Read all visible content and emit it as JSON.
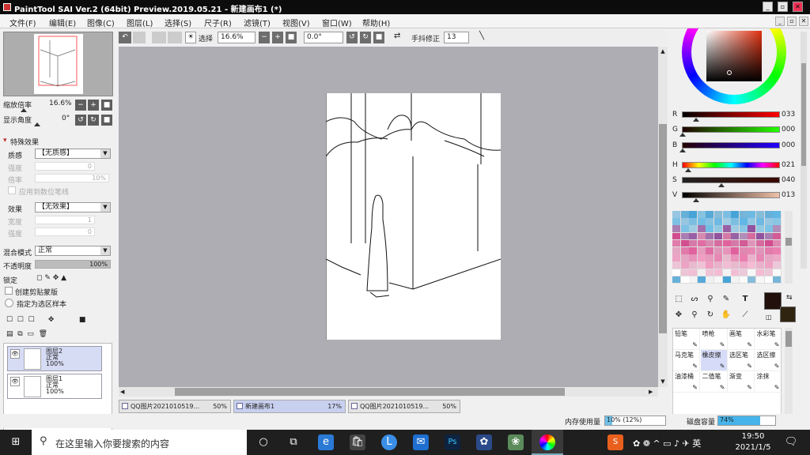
{
  "window": {
    "title": "PaintTool SAI Ver.2 (64bit) Preview.2019.05.21 - 新建画布1 (*)",
    "min": "_",
    "max": "▫",
    "close": "✕"
  },
  "menu": [
    "文件(F)",
    "编辑(E)",
    "图像(C)",
    "图层(L)",
    "选择(S)",
    "尺子(R)",
    "滤镜(T)",
    "视图(V)",
    "窗口(W)",
    "帮助(H)"
  ],
  "toolbar": {
    "select_label": "选择",
    "zoom": "16.6%",
    "angle": "0.0°",
    "stabilizer_label": "手抖修正",
    "stabilizer_value": "13"
  },
  "nav": {
    "zoom_label": "缩放倍率",
    "zoom_value": "16.6%",
    "angle_label": "显示角度",
    "angle_value": "0°"
  },
  "effects": {
    "section": "特殊效果",
    "texture_label": "质感",
    "texture_value": "【无质感】",
    "scale_label": "强度",
    "scale_value": "0",
    "ratio_label": "倍率",
    "ratio_value": "10%",
    "brush_tex": "应用到数位笔线",
    "effect_label": "效果",
    "effect_value": "【无效果】",
    "width_label": "宽度",
    "width_value": "1",
    "strength_label": "强度",
    "strength_value": "0"
  },
  "layerprops": {
    "blend_label": "混合模式",
    "blend_value": "正常",
    "opacity_label": "不透明度",
    "opacity_value": "100%",
    "lock_label": "锁定",
    "clip_label": "创建剪贴蒙版",
    "ref_label": "指定为选区样本"
  },
  "layers": [
    {
      "name": "图层2",
      "mode": "正常",
      "opacity": "100%"
    },
    {
      "name": "图层1",
      "mode": "正常",
      "opacity": "100%"
    }
  ],
  "tabs": [
    {
      "name": "QQ图片2021010519...",
      "pct": "50%"
    },
    {
      "name": "新建画布1",
      "pct": "17%"
    },
    {
      "name": "QQ图片2021010519...",
      "pct": "50%"
    }
  ],
  "color": {
    "R": "033",
    "G": "000",
    "B": "000",
    "H": "021",
    "S": "040",
    "V": "013",
    "primary": "#21100c",
    "secondary": "#2f2410"
  },
  "brushes": [
    [
      "铅笔",
      "喷枪",
      "画笔",
      "水彩笔"
    ],
    [
      "马克笔",
      "橡皮擦",
      "选区笔",
      "选区擦"
    ],
    [
      "油漆桶",
      "二值笔",
      "渐变",
      "涂抹"
    ]
  ],
  "status": {
    "mem_label": "内存使用量",
    "mem_value": "10% (12%)",
    "mem_fill": 0.12,
    "disk_label": "磁盘容量",
    "disk_value": "74%",
    "disk_fill": 0.74
  },
  "taskbar": {
    "search_placeholder": "在这里输入你要搜索的内容",
    "time": "19:50",
    "date": "2021/1/5"
  }
}
